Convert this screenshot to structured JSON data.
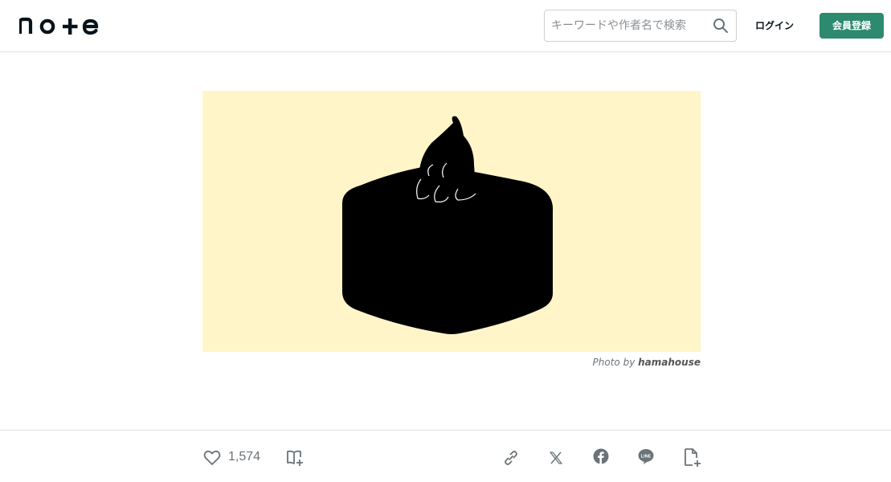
{
  "header": {
    "logo_text": "note",
    "search": {
      "placeholder": "キーワードや作者名で検索",
      "value": ""
    },
    "login_label": "ログイン",
    "signup_label": "会員登録",
    "accent_color": "#2d8a6e"
  },
  "eyecatch": {
    "background_color": "#fff5c8",
    "credit_prefix": "Photo by",
    "credit_name": "hamahouse"
  },
  "action_bar": {
    "like_count": "1,574",
    "icons": [
      "heart-icon",
      "magazine-add-icon",
      "link-icon",
      "x-icon",
      "facebook-icon",
      "line-icon",
      "note-embed-icon"
    ]
  }
}
